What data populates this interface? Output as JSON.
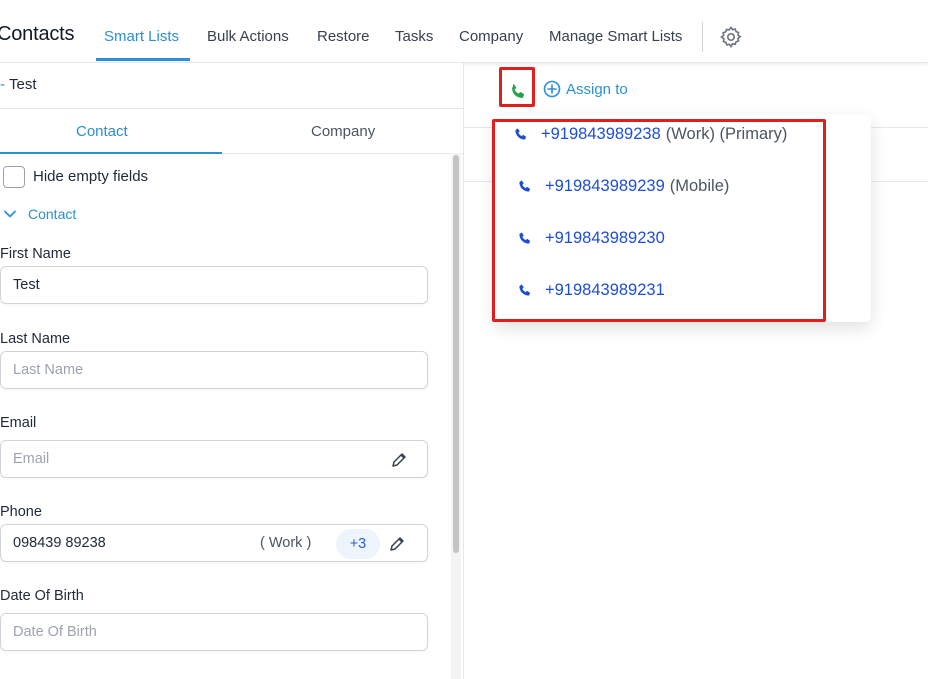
{
  "app": {
    "title": "Contacts"
  },
  "nav": {
    "tabs": [
      {
        "label": "Smart Lists",
        "active": true
      },
      {
        "label": "Bulk Actions"
      },
      {
        "label": "Restore"
      },
      {
        "label": "Tasks"
      },
      {
        "label": "Company"
      },
      {
        "label": "Manage Smart Lists"
      }
    ],
    "settings_icon": "gear-icon"
  },
  "record": {
    "name": "Test"
  },
  "panel_tabs": {
    "contact": "Contact",
    "company": "Company"
  },
  "options": {
    "hide_empty_label": "Hide empty fields",
    "hide_empty_checked": false
  },
  "section": {
    "label": "Contact",
    "expanded": true
  },
  "fields": {
    "first_name": {
      "label": "First Name",
      "value": "Test"
    },
    "last_name": {
      "label": "Last Name",
      "placeholder": "Last Name"
    },
    "email": {
      "label": "Email",
      "placeholder": "Email"
    },
    "phone": {
      "label": "Phone",
      "value": "098439 89238",
      "type": "( Work )",
      "more": "+3"
    },
    "dob": {
      "label": "Date Of Birth",
      "placeholder": "Date Of Birth"
    }
  },
  "actions": {
    "assign_label": "Assign to"
  },
  "phone_dropdown": [
    {
      "number": "+919843989238",
      "tags": "(Work) (Primary)"
    },
    {
      "number": "+919843989239",
      "tags": "(Mobile)"
    },
    {
      "number": "+919843989230",
      "tags": ""
    },
    {
      "number": "+919843989231",
      "tags": ""
    }
  ],
  "colors": {
    "accent": "#2b8fd6",
    "link": "#1d4ed8",
    "highlight": "#e11d1d",
    "call_green": "#22a447"
  }
}
